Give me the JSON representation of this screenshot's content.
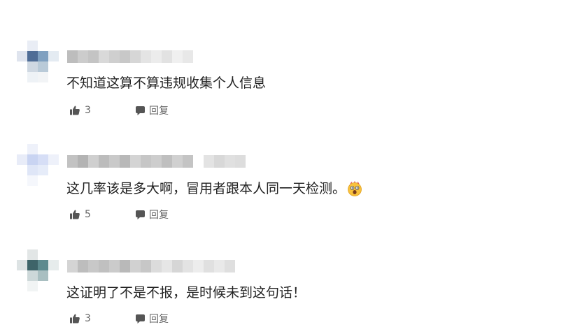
{
  "comments": [
    {
      "text": "不知道这算不算违规收集个人信息",
      "likes": "3",
      "reply_label": "回复",
      "avatar_icon": "pixelated-avatar",
      "has_emoji": false
    },
    {
      "text": "这几率该是多大啊，冒用者跟本人同一天检测。",
      "likes": "5",
      "reply_label": "回复",
      "avatar_icon": "pixelated-avatar",
      "has_emoji": true,
      "emoji_icon": "shocked-face-emoji"
    },
    {
      "text": "这证明了不是不报，是时候未到这句话！",
      "likes": "3",
      "reply_label": "回复",
      "avatar_icon": "pixelated-avatar",
      "has_emoji": false
    }
  ],
  "colors": {
    "text": "#222222",
    "meta": "#666666",
    "icon": "#555555",
    "background": "#ffffff"
  }
}
